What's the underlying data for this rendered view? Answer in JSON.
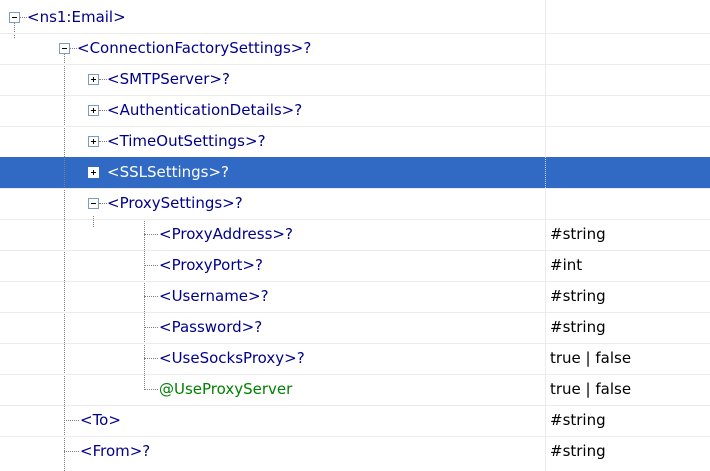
{
  "tree": {
    "rows": [
      {
        "label": "<ns1:Email>",
        "type": "",
        "kind": "element",
        "expander": "collapse",
        "selected": false
      },
      {
        "label": "<ConnectionFactorySettings>?",
        "type": "",
        "kind": "element",
        "expander": "collapse",
        "selected": false
      },
      {
        "label": "<SMTPServer>?",
        "type": "",
        "kind": "element",
        "expander": "expand",
        "selected": false
      },
      {
        "label": "<AuthenticationDetails>?",
        "type": "",
        "kind": "element",
        "expander": "expand",
        "selected": false
      },
      {
        "label": "<TimeOutSettings>?",
        "type": "",
        "kind": "element",
        "expander": "expand",
        "selected": false
      },
      {
        "label": "<SSLSettings>?",
        "type": "",
        "kind": "element",
        "expander": "expand",
        "selected": true
      },
      {
        "label": "<ProxySettings>?",
        "type": "",
        "kind": "element",
        "expander": "collapse",
        "selected": false
      },
      {
        "label": "<ProxyAddress>?",
        "type": "#string",
        "kind": "element",
        "expander": "none",
        "selected": false
      },
      {
        "label": "<ProxyPort>?",
        "type": "#int",
        "kind": "element",
        "expander": "none",
        "selected": false
      },
      {
        "label": "<Username>?",
        "type": "#string",
        "kind": "element",
        "expander": "none",
        "selected": false
      },
      {
        "label": "<Password>?",
        "type": "#string",
        "kind": "element",
        "expander": "none",
        "selected": false
      },
      {
        "label": "<UseSocksProxy>?",
        "type": "true | false",
        "kind": "element",
        "expander": "none",
        "selected": false
      },
      {
        "label": "@UseProxyServer",
        "type": "true | false",
        "kind": "attribute",
        "expander": "none",
        "selected": false
      },
      {
        "label": "<To>",
        "type": "#string",
        "kind": "element",
        "expander": "none",
        "selected": false
      },
      {
        "label": "<From>?",
        "type": "#string",
        "kind": "element",
        "expander": "none",
        "selected": false
      }
    ]
  },
  "icons": {
    "collapse": "minus-box-icon",
    "expand": "plus-box-icon"
  },
  "colors": {
    "element_text": "#00008b",
    "attribute_text": "#008000",
    "selection_background": "#316ac5",
    "selection_text": "#ffffff",
    "tree_line": "#808080",
    "expander_border": "#7f9db9"
  }
}
